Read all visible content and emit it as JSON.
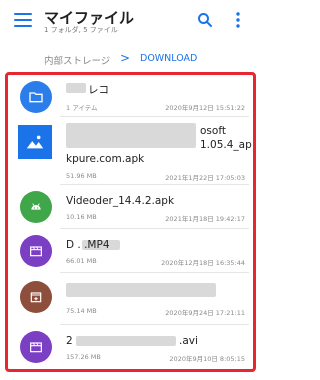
{
  "app": {
    "title": "マイファイル",
    "subtitle": "1 フォルダ, 5 ファイル"
  },
  "breadcrumb": {
    "parent": "内部ストレージ",
    "separator": ">",
    "current": "DOWNLOAD"
  },
  "icons": {
    "menu": "hamburger-menu-icon",
    "search": "search-icon",
    "more": "more-vertical-icon",
    "folder": "folder-icon",
    "image": "image-icon",
    "apk": "android-icon",
    "video": "video-clapper-icon",
    "archive": "archive-icon"
  },
  "colors": {
    "accent": "#1a73e8",
    "folder": "#2b7de9",
    "apk": "#3fa74a",
    "video": "#7b3fc4",
    "archive": "#8d4e3c",
    "highlight_border": "#e8262f"
  },
  "files": [
    {
      "name": "レコ",
      "meta": "1 アイテム",
      "date": "2020年9月12日 15:51:22"
    },
    {
      "name_line1": "osoft",
      "name_line2": "1.05.4_ap",
      "name_line3": "kpure.com.apk",
      "meta": "51.96 MB",
      "date": "2021年1月22日 17:05:03"
    },
    {
      "name": "Videoder_14.4.2.apk",
      "meta": "10.16 MB",
      "date": "2021年1月18日 19:42:17"
    },
    {
      "name": "D . .MP4",
      "meta": "66.01 MB",
      "date": "2020年12月18日 16:35:44"
    },
    {
      "name": "",
      "meta": "75.14 MB",
      "date": "2020年9月24日 17:21:11"
    },
    {
      "name_prefix": "2",
      "name_suffix": ".avi",
      "meta": "157.26 MB",
      "date": "2020年9月10日 8:05:15"
    }
  ]
}
